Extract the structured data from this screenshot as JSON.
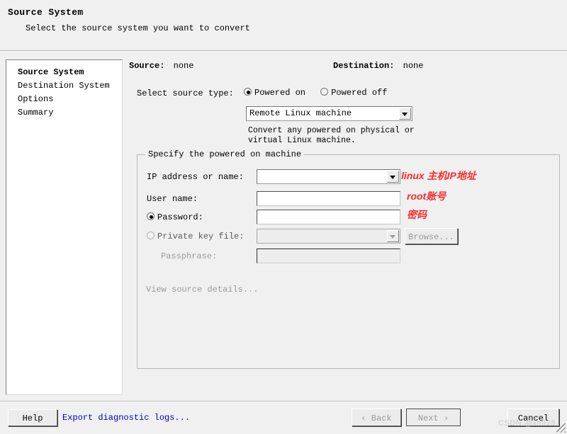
{
  "header": {
    "title": "Source System",
    "subtitle": "Select the source system you want to convert"
  },
  "sidebar": {
    "items": [
      {
        "label": "Source System",
        "selected": true
      },
      {
        "label": "Destination System",
        "selected": false
      },
      {
        "label": "Options",
        "selected": false
      },
      {
        "label": "Summary",
        "selected": false
      }
    ]
  },
  "status": {
    "source_label": "Source:",
    "source_value": "none",
    "destination_label": "Destination:",
    "destination_value": "none"
  },
  "source_type": {
    "label": "Select source type:",
    "options": [
      {
        "label": "Powered on",
        "selected": true
      },
      {
        "label": "Powered off",
        "selected": false
      }
    ],
    "machine_select_value": "Remote Linux machine",
    "description": "Convert any powered on physical or\nvirtual Linux machine."
  },
  "machine_group": {
    "legend": "Specify the powered on machine",
    "ip_label": "IP address or name:",
    "ip_value": "",
    "user_label": "User name:",
    "user_value": "",
    "password_radio_label": "Password:",
    "password_value": "",
    "privatekey_radio_label": "Private key file:",
    "privatekey_value": "",
    "browse_label": "Browse...",
    "passphrase_label": "Passphrase:",
    "passphrase_value": "",
    "view_details_label": "View source details..."
  },
  "annotations": [
    {
      "text": "linux 主机IP地址"
    },
    {
      "text": "root账号"
    },
    {
      "text": "密码"
    }
  ],
  "footer": {
    "help_label": "Help",
    "export_label": "Export diagnostic logs...",
    "back_label": "‹ Back",
    "next_label": "Next ›",
    "cancel_label": "Cancel",
    "watermark": "CSDN @xh928"
  },
  "colors": {
    "accent_link": "#0000cc",
    "annotation_red": "#ff2b2b",
    "window_bg": "#f0f0f0",
    "panel_bg": "#ffffff"
  }
}
